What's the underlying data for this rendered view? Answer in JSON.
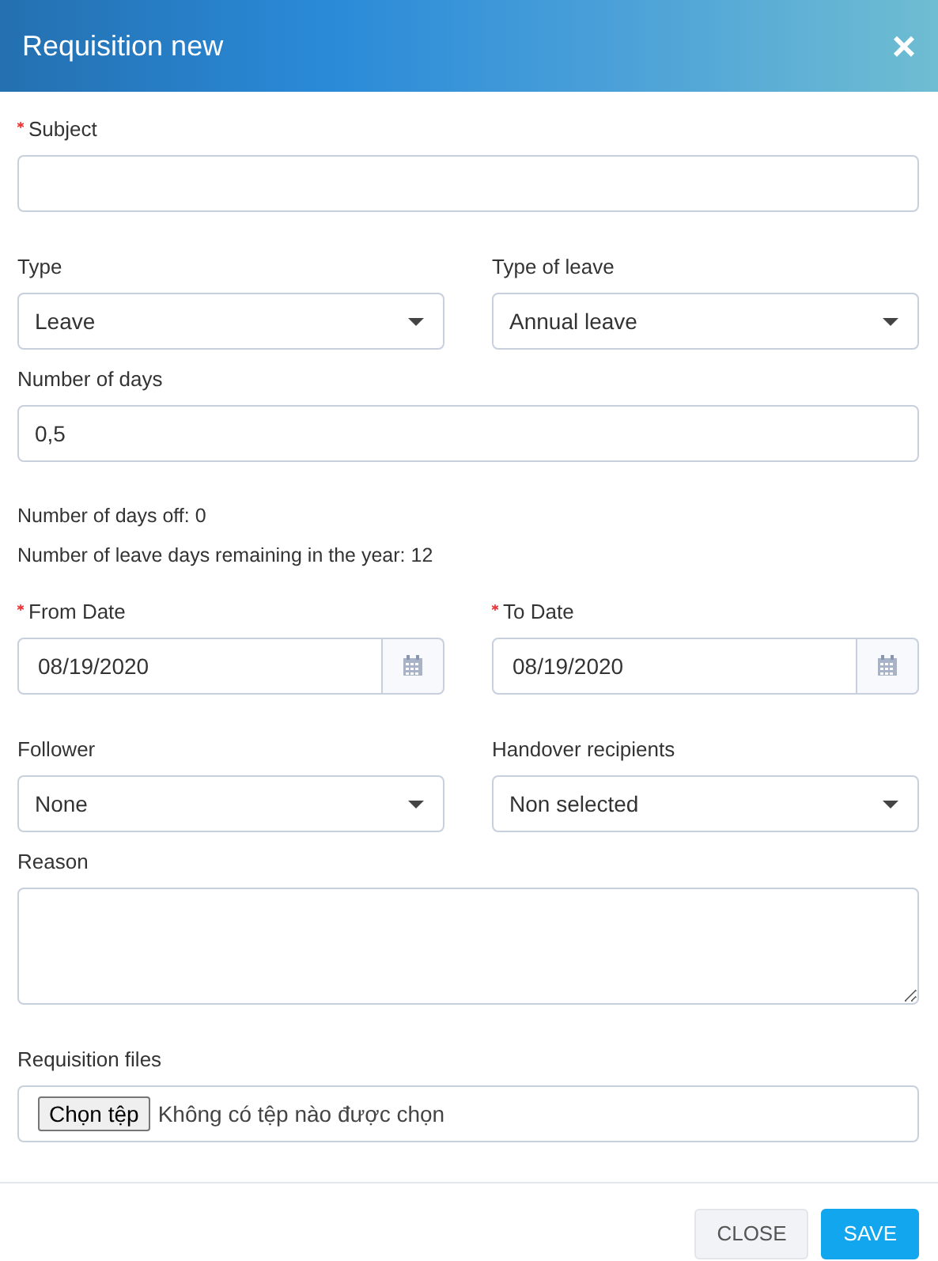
{
  "window": {
    "title": "Requisition new",
    "close": "×"
  },
  "rows": [
    {
      "kind": "fields",
      "fields": [
        {
          "kind": "text",
          "label": "Subject",
          "required": true
        }
      ]
    },
    {
      "kind": "fields",
      "fields": [
        {
          "kind": "select",
          "label": "Type",
          "required": false,
          "value": "Leave"
        },
        {
          "kind": "select",
          "label": "Type of leave",
          "required": false,
          "value": "Annual leave"
        }
      ]
    },
    {
      "kind": "fields",
      "fields": [
        {
          "kind": "text",
          "label": "Number of days",
          "required": false,
          "value": "0,5"
        }
      ]
    },
    {
      "kind": "note",
      "text": "Number of days off: 0"
    },
    {
      "kind": "note",
      "text": "Number of leave days remaining in the year: 12"
    },
    {
      "kind": "fields",
      "fields": [
        {
          "kind": "date",
          "label": "From Date",
          "required": true,
          "value": "08/19/2020"
        },
        {
          "kind": "date",
          "label": "To Date",
          "required": true,
          "value": "08/19/2020"
        }
      ]
    },
    {
      "kind": "fields",
      "fields": [
        {
          "kind": "select",
          "label": "Follower",
          "required": false,
          "value": "None"
        },
        {
          "kind": "select",
          "label": "Handover recipients",
          "required": false,
          "value": "Non selected"
        }
      ]
    },
    {
      "kind": "fields",
      "fields": [
        {
          "kind": "textarea",
          "label": "Reason",
          "required": false
        }
      ]
    },
    {
      "kind": "fields",
      "fields": [
        {
          "kind": "file",
          "label": "Requisition files",
          "required": false,
          "button": "Chọn tệp",
          "value": "Không có tệp nào được chọn"
        }
      ]
    }
  ],
  "buttons": [
    {
      "label": "CLOSE",
      "kind": "secondary"
    },
    {
      "label": "SAVE",
      "kind": "primary"
    }
  ]
}
